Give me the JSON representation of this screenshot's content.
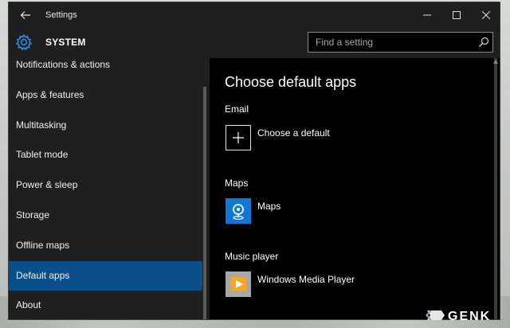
{
  "window": {
    "title": "Settings"
  },
  "header": {
    "section_title": "SYSTEM",
    "search_placeholder": "Find a setting"
  },
  "sidebar": {
    "items": [
      {
        "label": "Notifications & actions"
      },
      {
        "label": "Apps & features"
      },
      {
        "label": "Multitasking"
      },
      {
        "label": "Tablet mode"
      },
      {
        "label": "Power & sleep"
      },
      {
        "label": "Storage"
      },
      {
        "label": "Offline maps"
      },
      {
        "label": "Default apps",
        "selected": true
      },
      {
        "label": "About"
      }
    ]
  },
  "main": {
    "title": "Choose default apps",
    "sections": [
      {
        "label": "Email",
        "app": "Choose a default",
        "icon": "plus-icon"
      },
      {
        "label": "Maps",
        "app": "Maps",
        "icon": "maps-icon"
      },
      {
        "label": "Music player",
        "app": "Windows Media Player",
        "icon": "windows-media-player-icon"
      }
    ]
  },
  "watermark": {
    "text": "GENK"
  },
  "colors": {
    "accent": "#0a4f8a",
    "sidebar_bg": "#1f1f1f",
    "main_bg": "#000000",
    "maps_blue": "#0f78d7",
    "settings_icon_blue": "#2a8ee8"
  }
}
